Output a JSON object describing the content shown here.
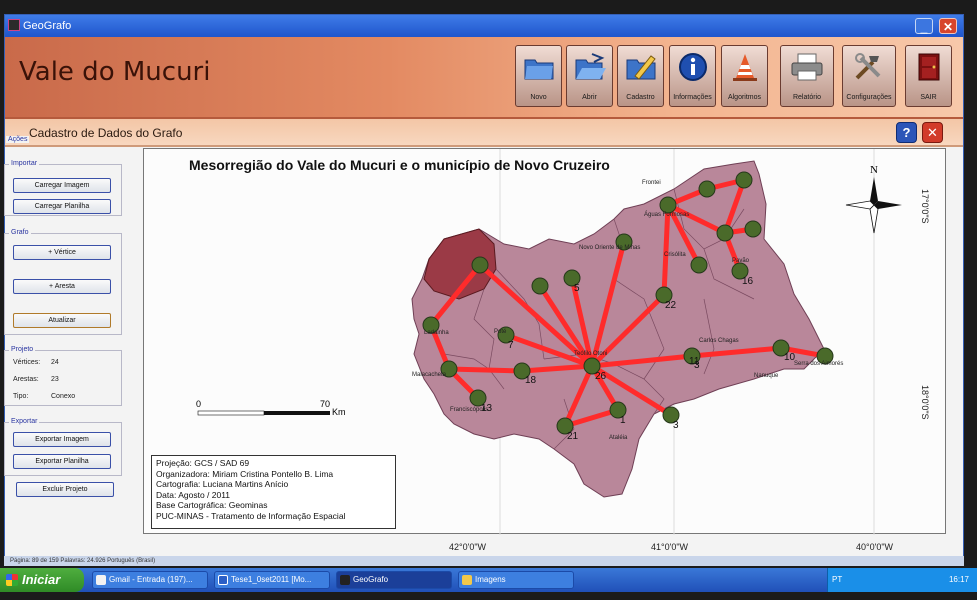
{
  "window": {
    "title": "GeoGrafo"
  },
  "header": {
    "app_title": "Vale do Mucuri",
    "toolbar": [
      {
        "id": "novo",
        "label": "Novo",
        "icon": "folder-icon"
      },
      {
        "id": "abrir",
        "label": "Abrir",
        "icon": "open-folder-icon"
      },
      {
        "id": "cadastro",
        "label": "Cadastro",
        "icon": "edit-folder-icon"
      },
      {
        "id": "informacoes",
        "label": "Informações",
        "icon": "info-icon"
      },
      {
        "id": "algoritmos",
        "label": "Algoritmos",
        "icon": "cone-icon"
      },
      {
        "id": "relatorio",
        "label": "Relatório",
        "icon": "printer-icon"
      },
      {
        "id": "configuracoes",
        "label": "Configurações",
        "icon": "tools-icon"
      },
      {
        "id": "sair",
        "label": "SAIR",
        "icon": "door-icon"
      }
    ]
  },
  "subheader": {
    "title": "Cadastro de Dados do Grafo",
    "help": "?",
    "close": "✕"
  },
  "sidebar": {
    "acoes_label": "Ações",
    "importar": {
      "label": "Importar",
      "carregar_imagem": "Carregar Imagem",
      "carregar_planilha": "Carregar Planilha"
    },
    "grafo": {
      "label": "Grafo",
      "vertice": "+ Vértice",
      "aresta": "+ Aresta",
      "atualizar": "Atualizar"
    },
    "projeto": {
      "label": "Projeto",
      "vertices_label": "Vértices:",
      "vertices_value": "24",
      "arestas_label": "Arestas:",
      "arestas_value": "23",
      "tipo_label": "Tipo:",
      "tipo_value": "Conexo"
    },
    "exportar": {
      "label": "Exportar",
      "exportar_imagem": "Exportar Imagem",
      "exportar_planilha": "Exportar Planilha",
      "excluir_projeto": "Excluir Projeto"
    }
  },
  "map": {
    "title": "Mesorregião do Vale do Mucuri e o município de Novo Cruzeiro",
    "north_label": "N",
    "scale": {
      "start": "0",
      "end": "70",
      "unit": "Km"
    },
    "info_lines": [
      "Projeção: GCS / SAD 69",
      "Organizadora: Miriam Cristina Pontello B. Lima",
      "Cartografia: Luciana Martins Anício",
      "Data: Agosto / 2011",
      "Base Cartográfica: Geominas",
      "PUC-MINAS - Tratamento de Informação Espacial"
    ],
    "lat_labels": [
      "17°0'0\"S",
      "18°0'0\"S"
    ],
    "lon_labels": [
      "42°0'0\"W",
      "41°0'0\"W",
      "40°0'0\"W"
    ],
    "place_labels": [
      "Frontei",
      "Malacacheta",
      "Teófilo Otoni",
      "Carlos Chagas",
      "Nanuque",
      "Serra dos Aimorés",
      "Novo Oriente de Minas",
      "Crisólita",
      "Ladainha",
      "Pavão",
      "Ataléia",
      "Franciscópolis",
      "Poté",
      "Águas Formosas"
    ],
    "node_labels": [
      "1",
      "2",
      "3",
      "5",
      "7",
      "10",
      "11",
      "13",
      "16",
      "18",
      "21",
      "22",
      "26"
    ]
  },
  "docstrip": {
    "text": "Página: 89 de 159    Palavras: 24.926    Português (Brasil)"
  },
  "taskbar": {
    "start": "Iniciar",
    "tasks": [
      "Gmail - Entrada (197)...",
      "Tese1_0set2011 [Mo...",
      "GeoGrafo",
      "Imagens"
    ],
    "lang": "PT",
    "clock": "16:17"
  },
  "colors": {
    "edge": "#ff2b2b",
    "node": "#4a6a2a",
    "region": "#b9879a",
    "highlight": "#9b3a46"
  }
}
